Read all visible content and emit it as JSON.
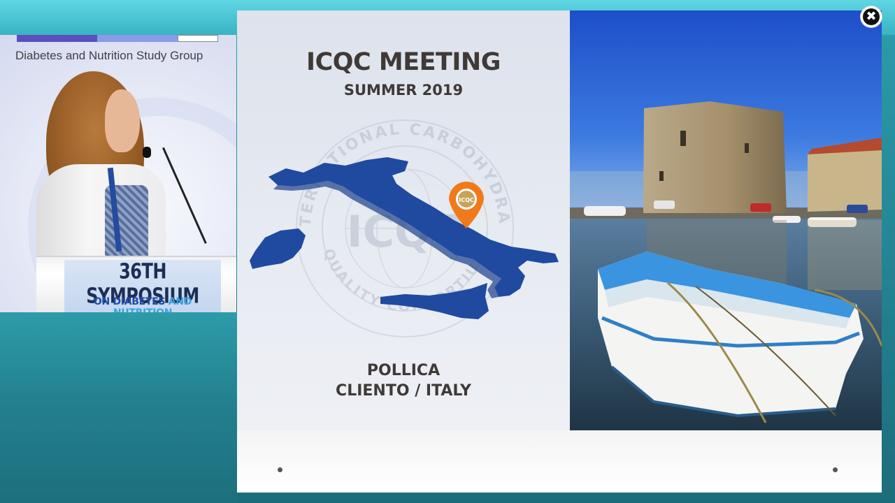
{
  "video": {
    "group_name": "Diabetes and Nutrition Study Group",
    "podium_title": "36TH SYMPOSIUM",
    "podium_sub_a": "ON DIABETES ",
    "podium_sub_b": "AND NUTRITION"
  },
  "slide": {
    "title": "ICQC MEETING",
    "subtitle": "SUMMER 2019",
    "location_line1": "POLLICA",
    "location_line2": "CLIENTO / ITALY",
    "seal_text_top": "INTERNATIONAL CARBOHYDRATE",
    "seal_text_bottom": "QUALITY CONSORTIUM",
    "seal_center": "ICQC",
    "pin_label": "ICQC",
    "map_color": "#1f4aa0"
  },
  "controls": {
    "close_glyph": "✖"
  }
}
